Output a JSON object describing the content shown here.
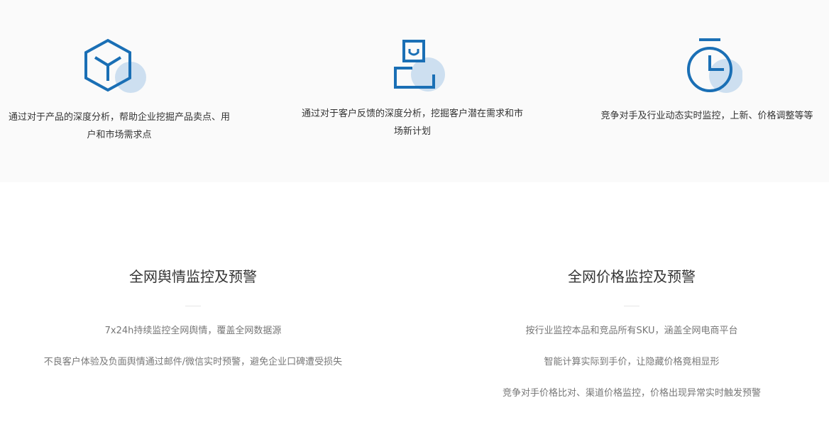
{
  "features": [
    {
      "icon": "cube-icon",
      "text": "通过对于产品的深度分析，帮助企业挖掘产品卖点、用户和市场需求点"
    },
    {
      "icon": "customer-icon",
      "text": "通过对于客户反馈的深度分析，挖掘客户潜在需求和市场新计划"
    },
    {
      "icon": "stopwatch-icon",
      "text": "竞争对手及行业动态实时监控，上新、价格调整等等"
    }
  ],
  "sections": [
    {
      "title": "全网舆情监控及预警",
      "items": [
        "7x24h持续监控全网舆情，覆盖全网数据源",
        "不良客户体验及负面舆情通过邮件/微信实时预警，避免企业口碑遭受损失"
      ]
    },
    {
      "title": "全网价格监控及预警",
      "items": [
        "按行业监控本品和竞品所有SKU，涵盖全网电商平台",
        "智能计算实际到手价，让隐藏价格竟相显形",
        "竞争对手价格比对、渠道价格监控，价格出现异常实时触发预警"
      ]
    }
  ],
  "colors": {
    "icon_stroke": "#1a6fb5",
    "icon_accent": "#cddff0",
    "band_bg": "#fafafa"
  }
}
